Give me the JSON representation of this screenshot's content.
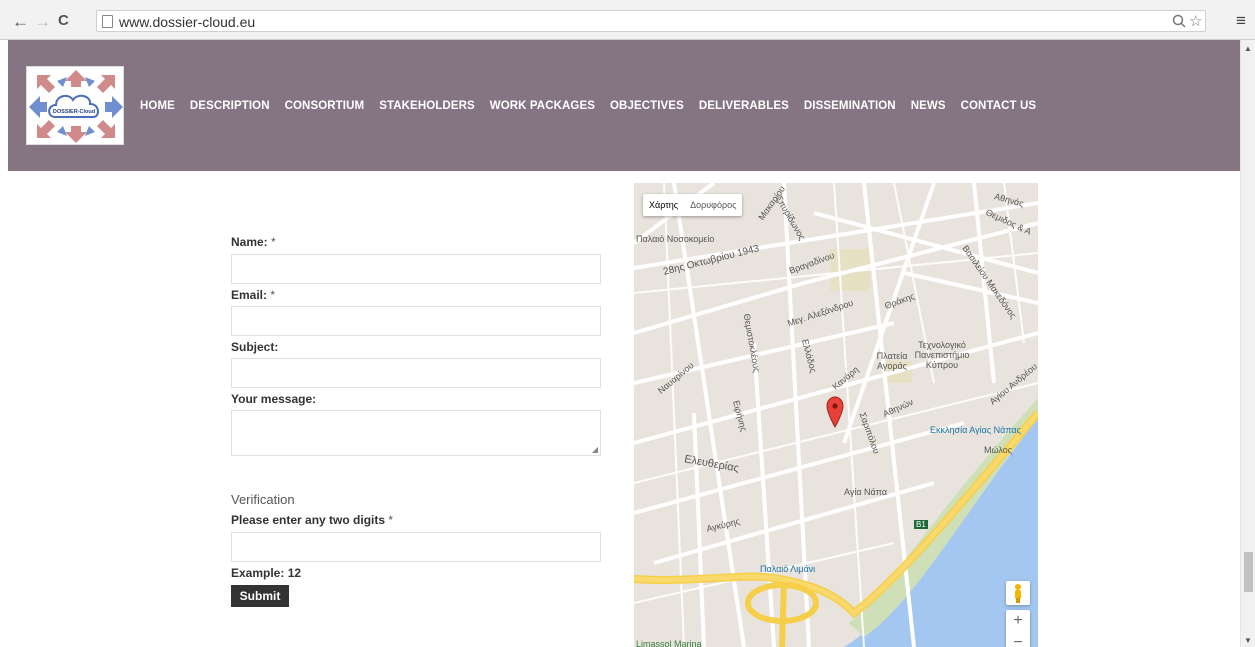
{
  "browser": {
    "back": "←",
    "forward": "→",
    "reload": "C",
    "url": "www.dossier-cloud.eu",
    "zoom_icon": "magnifier-icon",
    "star_icon": "star-icon",
    "menu_icon": "hamburger-menu-icon"
  },
  "header": {
    "logo_text": "DOSSIER-Cloud",
    "nav": [
      "HOME",
      "DESCRIPTION",
      "CONSORTIUM",
      "STAKEHOLDERS",
      "WORK PACKAGES",
      "OBJECTIVES",
      "DELIVERABLES",
      "DISSEMINATION",
      "NEWS",
      "CONTACT US"
    ],
    "bg_color": "#857481"
  },
  "form": {
    "name_label": "Name:",
    "email_label": "Email:",
    "subject_label": "Subject:",
    "message_label": "Your message:",
    "required_marker": "*",
    "verification_title": "Verification",
    "digits_label": "Please enter any two digits",
    "example": "Example: 12",
    "submit_label": "Submit"
  },
  "map": {
    "tab_map": "Χάρτης",
    "tab_satellite": "Δορυφόρος",
    "labels": [
      "Παλαιό Νοσοκομείο",
      "28ης Οκτωβρίου 1943",
      "Βραγαδίνου",
      "Μεγ. Αλεξάνδρου",
      "Θράκης",
      "Θεμιστοκλέους",
      "Ελλάδος",
      "Κανάρη",
      "Πλατεία Αγοράς",
      "Τεχνολογικό Πανεπιστήμιο Κύπρου",
      "Αθηνών",
      "Ειρήνης",
      "Ελευθερίας",
      "Εκκλησία Αγίας Νάπας",
      "Μώλος",
      "Αγία Νάπα",
      "Αγκύρης",
      "Παλαιό Λιμάνι",
      "Limassol Marina",
      "Σαριπόλου",
      "Ναυαρίνου",
      "Αθηνάς",
      "Θεμιδος & Α",
      "Μακαρίου",
      "Σπυρίδωνος",
      "Αγίου Ανδρέου",
      "Βασιλείου Μακεδόνος",
      "Β1"
    ],
    "zoom_in": "+",
    "zoom_out": "−",
    "pin_icon": "map-pin-icon",
    "pegman_icon": "street-view-pegman-icon"
  }
}
